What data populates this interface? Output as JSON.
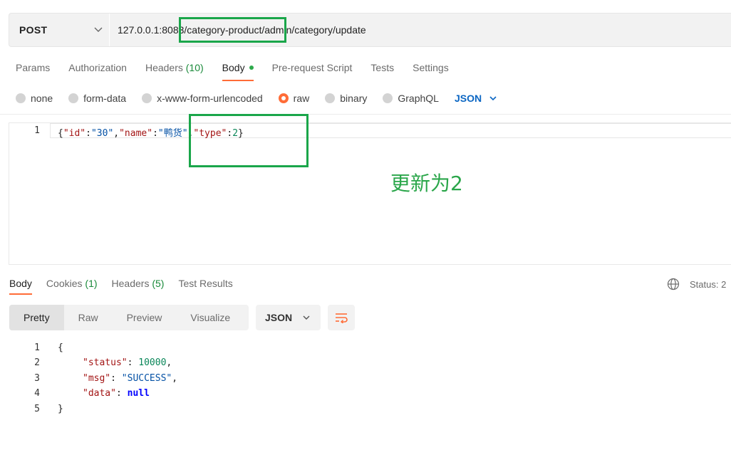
{
  "request": {
    "method": "POST",
    "url": "127.0.0.1:8083/category-product/admin/category/update"
  },
  "tabs": [
    {
      "label": "Params"
    },
    {
      "label": "Authorization"
    },
    {
      "label": "Headers",
      "count": "(10)"
    },
    {
      "label": "Body"
    },
    {
      "label": "Pre-request Script"
    },
    {
      "label": "Tests"
    },
    {
      "label": "Settings"
    }
  ],
  "body_types": [
    "none",
    "form-data",
    "x-www-form-urlencoded",
    "raw",
    "binary",
    "GraphQL"
  ],
  "body_format": "JSON",
  "editor": {
    "line_number": "1",
    "tokens": {
      "open": "{",
      "k1": "\"id\"",
      "c1": ":",
      "v1": "\"30\"",
      "sep1": ",",
      "k2": "\"name\"",
      "c2": ":",
      "v2": "\"鸭货\"",
      "sep2": ",",
      "k3": "\"type\"",
      "c3": ":",
      "v3": "2",
      "close": "}"
    }
  },
  "annotation": "更新为2",
  "response": {
    "tabs": [
      {
        "label": "Body"
      },
      {
        "label": "Cookies",
        "count": "(1)"
      },
      {
        "label": "Headers",
        "count": "(5)"
      },
      {
        "label": "Test Results"
      }
    ],
    "status_label": "Status: 2",
    "views": [
      "Pretty",
      "Raw",
      "Preview",
      "Visualize"
    ],
    "format": "JSON",
    "lines": [
      {
        "n": "1",
        "open": "{"
      },
      {
        "n": "2",
        "key": "\"status\"",
        "colon": ": ",
        "val": "10000",
        "tail": ","
      },
      {
        "n": "3",
        "key": "\"msg\"",
        "colon": ": ",
        "val": "\"SUCCESS\"",
        "tail": ","
      },
      {
        "n": "4",
        "key": "\"data\"",
        "colon": ": ",
        "val": "null",
        "tail": ""
      },
      {
        "n": "5",
        "close": "}"
      }
    ]
  },
  "colors": {
    "accent": "#ff6c37",
    "annotation": "#1aa64a",
    "json_link": "#0b66c3"
  }
}
